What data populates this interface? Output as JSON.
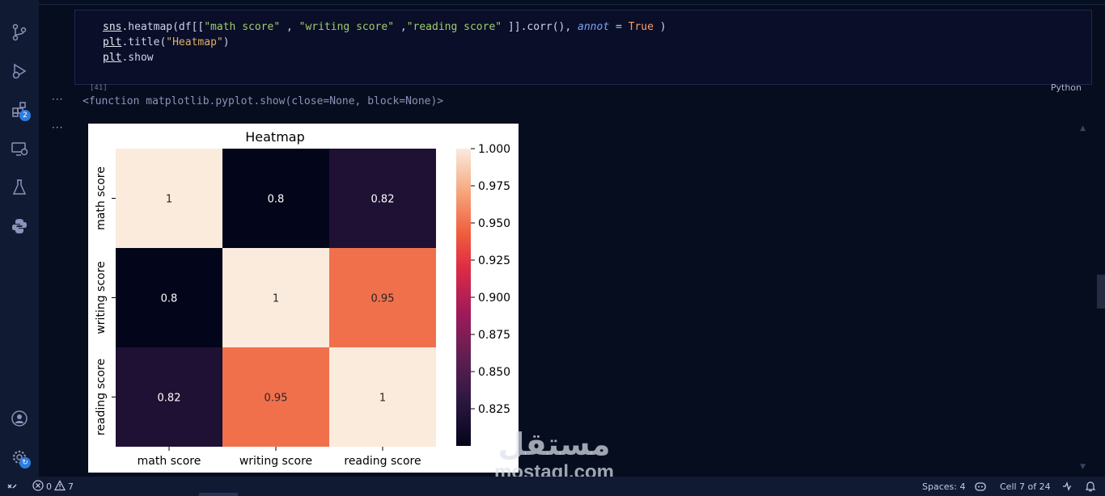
{
  "cell": {
    "execution_count": "[41]",
    "language": "Python",
    "lines": [
      {
        "parts": [
          "sns",
          ".heatmap(df[[",
          "\"math score\"",
          " , ",
          "\"writing score\"",
          " ,",
          "\"reading score\"",
          " ]].corr(), ",
          "annot",
          " = ",
          "True",
          " )"
        ]
      },
      {
        "parts": [
          "plt",
          ".title(",
          "\"Heatmap\"",
          ")"
        ]
      },
      {
        "parts": [
          "plt",
          ".show"
        ]
      }
    ]
  },
  "output": {
    "ellipsis": "···",
    "text": "<function matplotlib.pyplot.show(close=None, block=None)>"
  },
  "chart_data": {
    "type": "heatmap",
    "title": "Heatmap",
    "categories": [
      "math score",
      "writing score",
      "reading score"
    ],
    "values": [
      [
        1,
        0.8,
        0.82
      ],
      [
        0.8,
        1,
        0.95
      ],
      [
        0.82,
        0.95,
        1
      ]
    ],
    "annotations": [
      [
        "1",
        "0.8",
        "0.82"
      ],
      [
        "0.8",
        "1",
        "0.95"
      ],
      [
        "0.82",
        "0.95",
        "1"
      ]
    ],
    "colorbar": {
      "range": [
        0.8,
        1.0
      ],
      "ticks": [
        1.0,
        0.975,
        0.95,
        0.925,
        0.9,
        0.875,
        0.85,
        0.825
      ],
      "tick_labels": [
        "1.000",
        "0.975",
        "0.950",
        "0.925",
        "0.900",
        "0.875",
        "0.850",
        "0.825"
      ],
      "colormap": "rocket"
    }
  },
  "activity_bar": {
    "items": [
      {
        "name": "source-control-icon"
      },
      {
        "name": "run-debug-icon"
      },
      {
        "name": "extensions-icon",
        "badge": "2"
      },
      {
        "name": "remote-explorer-icon"
      },
      {
        "name": "testing-icon"
      },
      {
        "name": "python-icon"
      }
    ],
    "account": "account-icon",
    "settings": "settings-gear-icon"
  },
  "status_bar": {
    "errors": "0",
    "warnings": "7",
    "spaces": "Spaces: 4",
    "cell_position": "Cell 7 of 24"
  },
  "watermark": {
    "arabic": "مستقل",
    "latin": "mostaql.com"
  },
  "colors": {
    "editor_bg": "#060d1e",
    "cell_bg": "#0a0e28",
    "activity_bg": "#101a33"
  }
}
